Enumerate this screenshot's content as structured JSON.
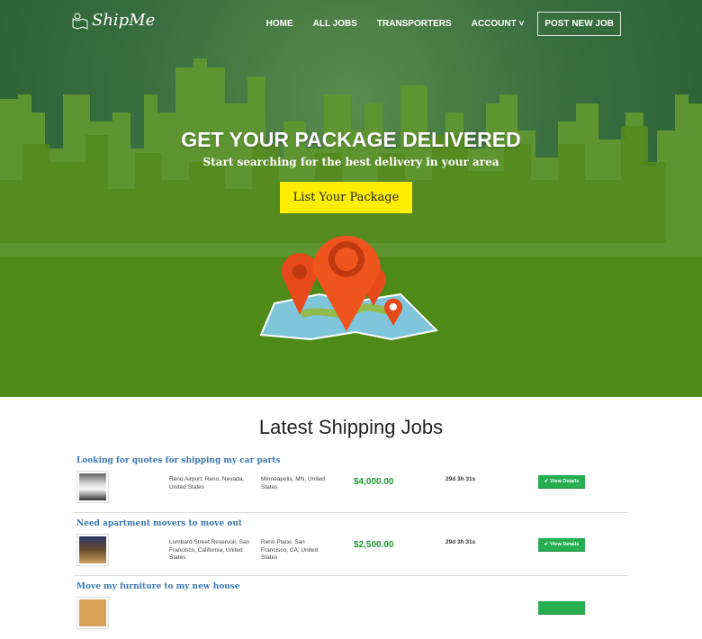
{
  "header": {
    "logo": "ShipMe",
    "nav": [
      "HOME",
      "ALL JOBS",
      "TRANSPORTERS",
      "ACCOUNT ˅"
    ],
    "post_job": "POST NEW JOB"
  },
  "hero": {
    "headline": "GET YOUR PACKAGE DELIVERED",
    "subheadline": "Start searching for the best delivery in your area",
    "cta": "List Your Package"
  },
  "jobs_section": {
    "title": "Latest Shipping Jobs",
    "view_label": "View Details",
    "jobs": [
      {
        "title": "Looking for quotes for shipping my car parts",
        "from": "Reno Airport, Reno, Nevada, United States",
        "to": "Minneapolis, MN, United States",
        "price": "$4,000.00",
        "time_left": "29d 3h 31s"
      },
      {
        "title": "Need apartment movers to move out",
        "from": "Lombard Street Reservoir, San Francisco, California, United States",
        "to": "Reno Place, San Francisco, CA, United States",
        "price": "$2,500.00",
        "time_left": "29d 3h 31s"
      },
      {
        "title": "Move my furniture to my new house"
      }
    ]
  },
  "colors": {
    "accent": "#ffee00",
    "link": "#3a78b5",
    "price": "#1e9a2e",
    "button": "#27ae50"
  }
}
